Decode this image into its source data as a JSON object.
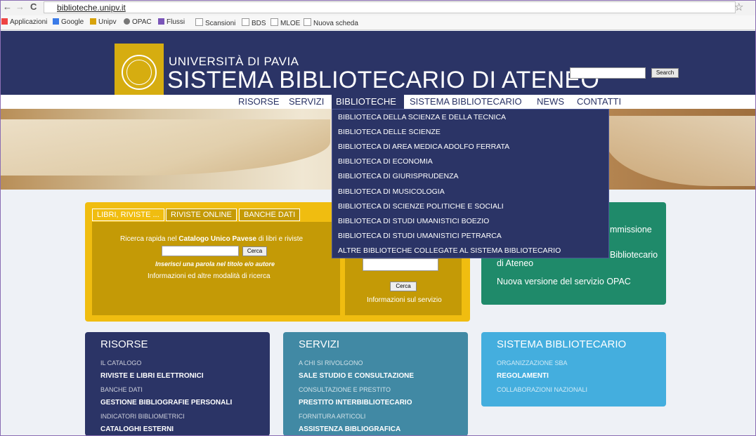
{
  "browser": {
    "back": "←",
    "forward": "→",
    "reload": "C",
    "url": "biblioteche.unipv.it",
    "star": "☆",
    "bookmarks": [
      "Applicazioni",
      "Google",
      "Unipv",
      "OPAC",
      "Flussi",
      "Scansioni",
      "BDS",
      "MLOE",
      "Nuova scheda"
    ]
  },
  "header": {
    "university": "UNIVERSITÀ DI PAVIA",
    "title": "SISTEMA BIBLIOTECARIO DI ATENEO",
    "search_button": "Search"
  },
  "menu": [
    "RISORSE",
    "SERVIZI",
    "BIBLIOTECHE",
    "SISTEMA BIBLIOTECARIO",
    "NEWS",
    "CONTATTI"
  ],
  "dropdown": [
    "BIBLIOTECA DELLA SCIENZA E DELLA TECNICA",
    "BIBLIOTECA DELLE SCIENZE",
    "BIBLIOTECA DI AREA MEDICA ADOLFO FERRATA",
    "BIBLIOTECA DI ECONOMIA",
    "BIBLIOTECA DI GIURISPRUDENZA",
    "BIBLIOTECA DI MUSICOLOGIA",
    "BIBLIOTECA DI SCIENZE POLITICHE E SOCIALI",
    "BIBLIOTECA DI STUDI UMANISTICI BOEZIO",
    "BIBLIOTECA DI STUDI UMANISTICI PETRARCA",
    "ALTRE BIBLIOTECHE COLLEGATE AL SISTEMA BIBLIOTECARIO"
  ],
  "search_panel": {
    "tabs": [
      "LIBRI, RIVISTE ...",
      "RIVISTE ONLINE",
      "BANCHE DATI"
    ],
    "quick_prefix": "Ricerca rapida nel ",
    "quick_catalog": "Catalogo Unico Pavese",
    "quick_suffix": " di libri e riviste",
    "quick_button": "Cerca",
    "hint": "Inserisci una parola nel titolo e/o autore",
    "info": "Informazioni ed altre modalità di ricerca",
    "right_button": "Cerca",
    "right_info": "Informazioni sul servizio"
  },
  "news_panel": {
    "line1": "mmissione",
    "line2a": "Bibliotecario",
    "line2b": "di Ateneo",
    "line3": "Nuova versione del servizio OPAC"
  },
  "boxes": {
    "risorse": {
      "title": "RISORSE",
      "items": [
        "IL CATALOGO",
        "RIVISTE E LIBRI ELETTRONICI",
        "BANCHE DATI",
        "GESTIONE BIBLIOGRAFIE PERSONALI",
        "INDICATORI BIBLIOMETRICI",
        "CATALOGHI ESTERNI"
      ]
    },
    "servizi": {
      "title": "SERVIZI",
      "items": [
        "A CHI SI RIVOLGONO",
        "SALE STUDIO E CONSULTAZIONE",
        "CONSULTAZIONE E PRESTITO",
        "PRESTITO INTERBIBLIOTECARIO",
        "FORNITURA ARTICOLI",
        "ASSISTENZA BIBLIOGRAFICA"
      ]
    },
    "sistema": {
      "title": "SISTEMA BIBLIOTECARIO",
      "items": [
        "ORGANIZZAZIONE SBA",
        "REGOLAMENTI",
        "COLLABORAZIONI NAZIONALI"
      ]
    }
  },
  "colors": {
    "navy": "#2b3466",
    "gold": "#f0bd10",
    "green": "#1f8a6a",
    "teal": "#4189a4",
    "sky": "#44aede"
  }
}
